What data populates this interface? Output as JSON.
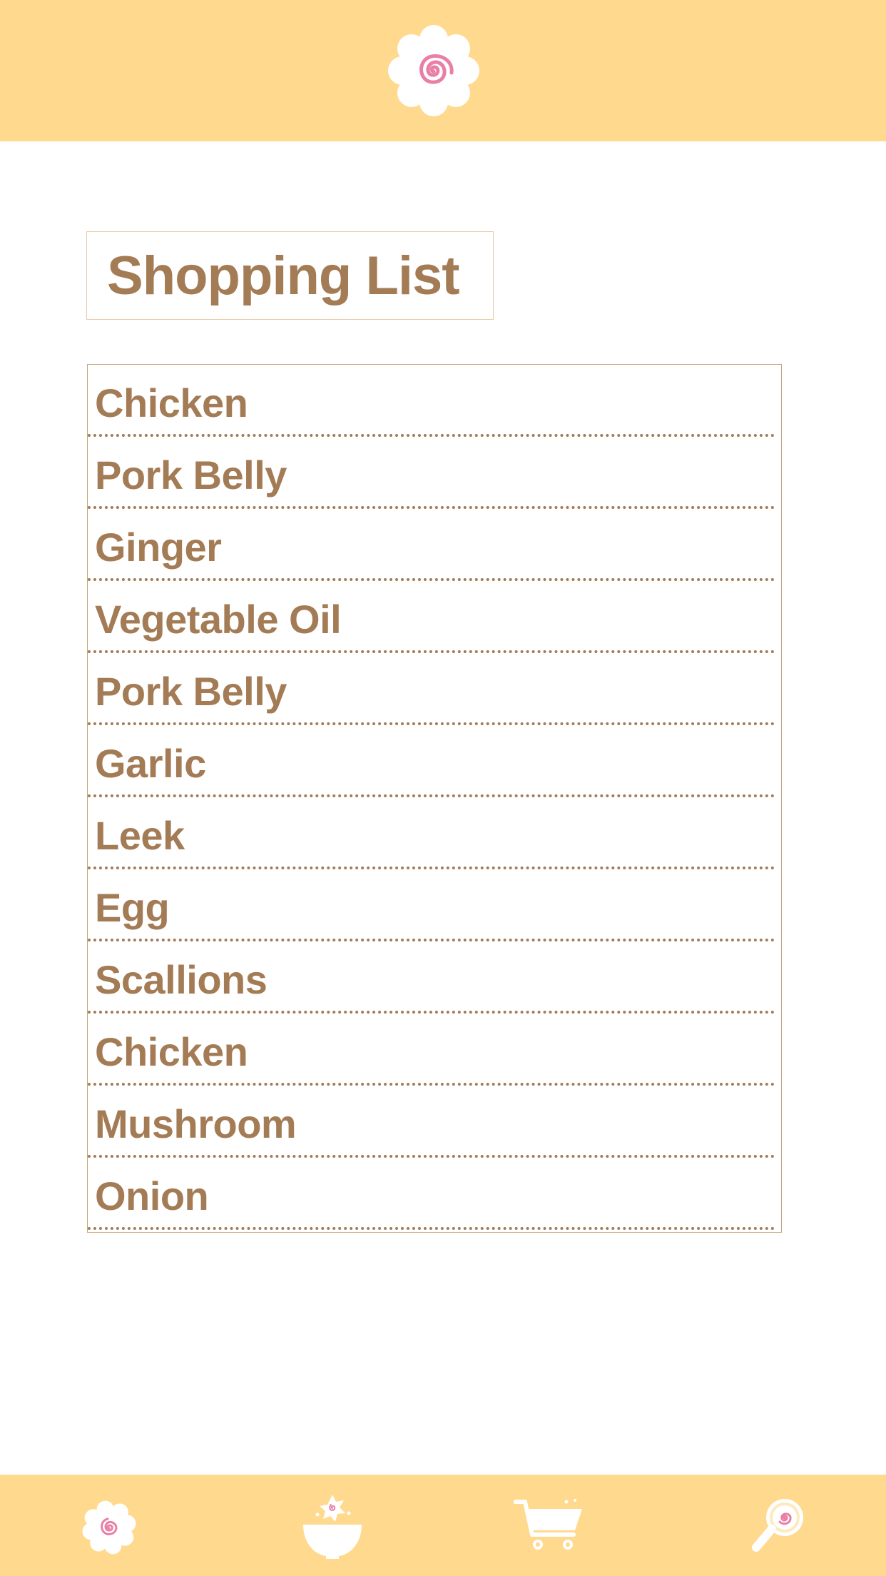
{
  "header": {
    "logo_icon": "naruto-fishcake-icon"
  },
  "page": {
    "title": "Shopping List"
  },
  "shopping_list": {
    "items": [
      {
        "label": "Chicken"
      },
      {
        "label": "Pork Belly"
      },
      {
        "label": "Ginger"
      },
      {
        "label": "Vegetable Oil"
      },
      {
        "label": "Pork Belly"
      },
      {
        "label": "Garlic"
      },
      {
        "label": "Leek"
      },
      {
        "label": "Egg"
      },
      {
        "label": "Scallions"
      },
      {
        "label": "Chicken"
      },
      {
        "label": "Mushroom"
      },
      {
        "label": "Onion"
      }
    ]
  },
  "tabbar": {
    "tabs": [
      {
        "icon": "naruto-fishcake-icon"
      },
      {
        "icon": "ramen-bowl-icon"
      },
      {
        "icon": "shopping-cart-icon"
      },
      {
        "icon": "search-magnifier-icon"
      }
    ]
  },
  "colors": {
    "accent": "#FFD98E",
    "text": "#A37B55",
    "spiral": "#E97FA6",
    "border": "#C8A27A"
  }
}
